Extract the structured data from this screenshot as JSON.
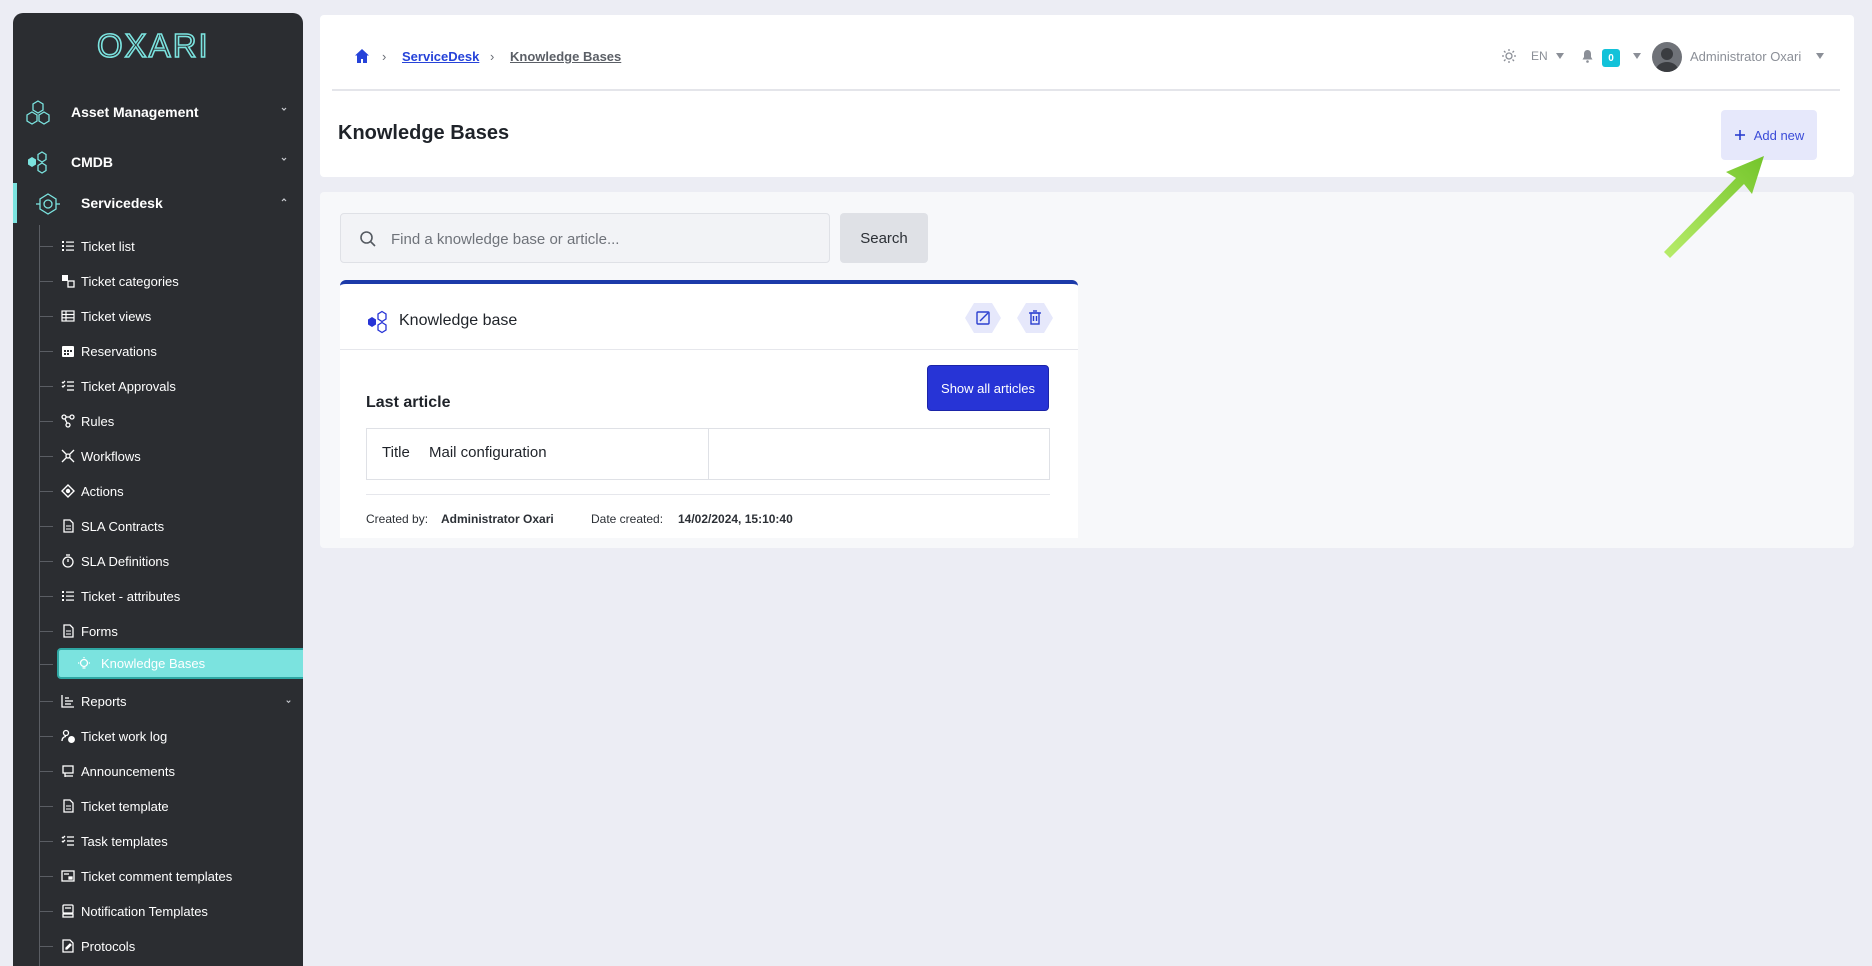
{
  "brand": {
    "logo_text": "OXARI"
  },
  "sidebar": {
    "top_items": [
      {
        "label": "Asset Management",
        "icon": "hexagons-icon"
      },
      {
        "label": "CMDB",
        "icon": "hexagon-cluster-icon"
      },
      {
        "label": "Servicedesk",
        "icon": "servicedesk-icon",
        "active": true
      }
    ],
    "sub_items": [
      {
        "label": "Ticket list",
        "icon": "list-icon"
      },
      {
        "label": "Ticket categories",
        "icon": "categories-icon"
      },
      {
        "label": "Ticket views",
        "icon": "table-icon"
      },
      {
        "label": "Reservations",
        "icon": "calendar-icon"
      },
      {
        "label": "Ticket Approvals",
        "icon": "checklist-icon"
      },
      {
        "label": "Rules",
        "icon": "rules-icon"
      },
      {
        "label": "Workflows",
        "icon": "workflow-icon"
      },
      {
        "label": "Actions",
        "icon": "actions-icon"
      },
      {
        "label": "SLA Contracts",
        "icon": "document-icon"
      },
      {
        "label": "SLA Definitions",
        "icon": "stopwatch-icon"
      },
      {
        "label": "Ticket - attributes",
        "icon": "list-icon"
      },
      {
        "label": "Forms",
        "icon": "document-icon"
      },
      {
        "label": "Knowledge Bases",
        "icon": "lightbulb-icon",
        "selected": true
      },
      {
        "label": "Reports",
        "icon": "chart-icon",
        "expandable": true
      },
      {
        "label": "Ticket work log",
        "icon": "user-clock-icon"
      },
      {
        "label": "Announcements",
        "icon": "announcement-icon"
      },
      {
        "label": "Ticket template",
        "icon": "document-icon"
      },
      {
        "label": "Task templates",
        "icon": "checklist-icon"
      },
      {
        "label": "Ticket comment templates",
        "icon": "comment-template-icon"
      },
      {
        "label": "Notification Templates",
        "icon": "notification-template-icon"
      },
      {
        "label": "Protocols",
        "icon": "protocol-icon"
      }
    ]
  },
  "header": {
    "breadcrumb": [
      {
        "label": "ServiceDesk",
        "color": "#2643d9"
      },
      {
        "label": "Knowledge Bases",
        "color": "#5b5f66"
      }
    ],
    "page_title": "Knowledge Bases",
    "add_button": "Add new",
    "language": "EN",
    "notification_count": "0",
    "user_name": "Administrator Oxari"
  },
  "search": {
    "placeholder": "Find a knowledge base or article...",
    "button": "Search"
  },
  "knowledge_base": {
    "name": "Knowledge base",
    "last_article_heading": "Last article",
    "show_all_button": "Show all articles",
    "article_key": "Title",
    "article_value": "Mail configuration",
    "created_by_label": "Created by:",
    "created_by_value": "Administrator Oxari",
    "date_created_label": "Date created:",
    "date_created_value": "14/02/2024, 15:10:40"
  },
  "colors": {
    "sidebar_bg": "#2b2d31",
    "accent_teal": "#7be3df",
    "primary_blue": "#2734d6",
    "card_top_border": "#1c3aa9",
    "badge": "#12c2d9",
    "arrow_green": "#86d13a"
  }
}
